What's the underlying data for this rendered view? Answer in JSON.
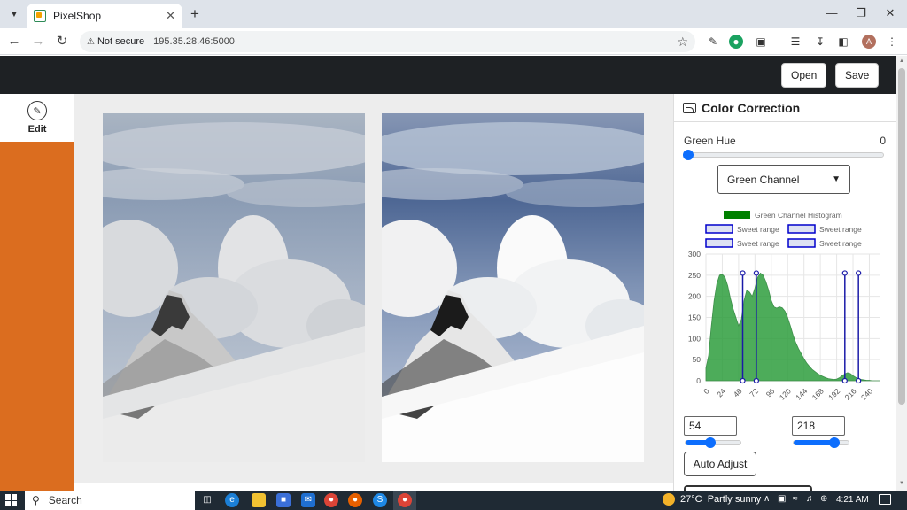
{
  "browser": {
    "tab_title": "PixelShop",
    "url_secure_label": "Not secure",
    "url": "195.35.28.46:5000",
    "avatar_letter": "A"
  },
  "header": {
    "open_label": "Open",
    "save_label": "Save"
  },
  "sidebar": {
    "edit_label": "Edit"
  },
  "panel": {
    "title": "Color Correction",
    "hue_label": "Green Hue",
    "hue_value": "0",
    "channel_selected": "Green Channel",
    "low_value": "54",
    "high_value": "218",
    "auto_adjust_label": "Auto Adjust"
  },
  "chart_data": {
    "type": "area",
    "legend": [
      {
        "name": "Green Channel Histogram",
        "color": "#008000"
      },
      {
        "name": "Sweet range",
        "color": "#0000cc"
      },
      {
        "name": "Sweet range",
        "color": "#0000cc"
      },
      {
        "name": "Sweet range",
        "color": "#0000cc"
      },
      {
        "name": "Sweet range",
        "color": "#0000cc"
      }
    ],
    "x_ticks": [
      "0",
      "24",
      "48",
      "72",
      "96",
      "120",
      "144",
      "168",
      "192",
      "216",
      "240"
    ],
    "y_ticks": [
      "0",
      "50",
      "100",
      "150",
      "200",
      "250",
      "300"
    ],
    "xlim": [
      0,
      255
    ],
    "ylim": [
      0,
      300
    ],
    "histogram": {
      "x": [
        0,
        4,
        8,
        12,
        16,
        20,
        24,
        28,
        32,
        36,
        40,
        44,
        48,
        52,
        56,
        60,
        64,
        68,
        72,
        76,
        80,
        84,
        88,
        92,
        96,
        100,
        104,
        108,
        112,
        116,
        120,
        124,
        128,
        132,
        136,
        140,
        144,
        148,
        152,
        156,
        160,
        164,
        168,
        172,
        176,
        180,
        184,
        188,
        192,
        196,
        200,
        204,
        208,
        212,
        216,
        220,
        224,
        228,
        232,
        236,
        240,
        244,
        248,
        252,
        255
      ],
      "y": [
        30,
        60,
        130,
        190,
        230,
        250,
        252,
        245,
        225,
        195,
        170,
        150,
        130,
        145,
        190,
        215,
        210,
        200,
        220,
        245,
        255,
        250,
        235,
        215,
        190,
        175,
        172,
        175,
        173,
        165,
        150,
        130,
        108,
        90,
        76,
        64,
        52,
        42,
        34,
        27,
        22,
        17,
        13,
        10,
        7,
        5,
        4,
        3,
        4,
        7,
        12,
        16,
        19,
        17,
        12,
        8,
        5,
        3,
        2,
        1,
        1,
        0,
        0,
        0,
        0
      ],
      "color": "#2e9e3e"
    },
    "sweet_range_markers": [
      54,
      74,
      204,
      224
    ],
    "marker_top": 255,
    "grid": true
  }
}
